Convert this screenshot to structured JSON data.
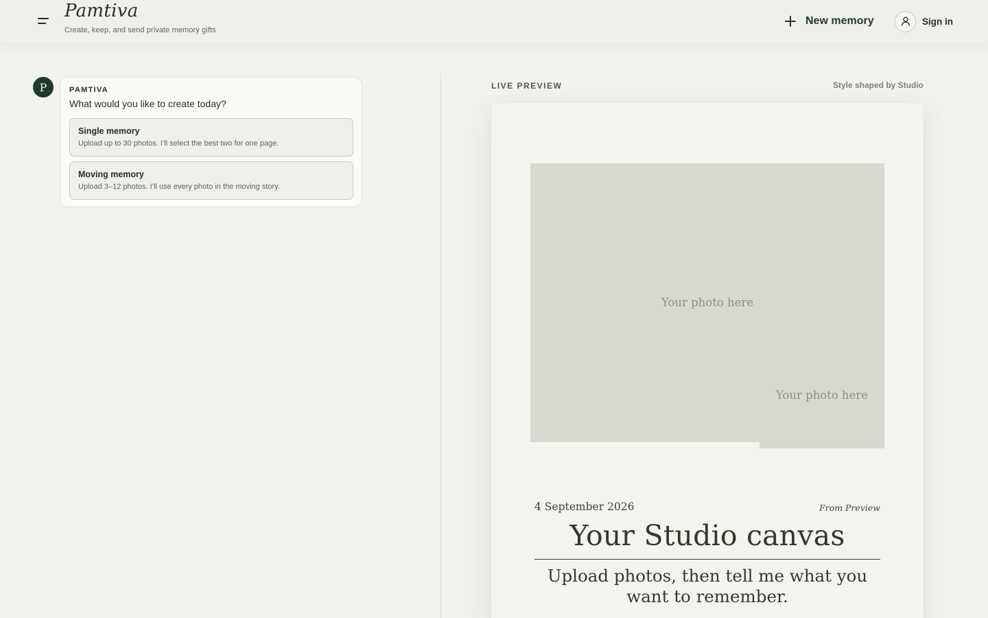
{
  "header": {
    "brand": "Pamtiva",
    "tagline": "Create, keep, and send private memory gifts",
    "new_memory_label": "New memory",
    "sign_in_label": "Sign in",
    "menu_icon": "menu-icon",
    "user_icon": "user-icon",
    "plus_icon": "plus-icon"
  },
  "chat": {
    "avatar_letter": "P",
    "sender": "PAMTIVA",
    "question": "What would you like to create today?",
    "options": [
      {
        "title": "Single memory",
        "description": "Upload up to 30 photos. I’ll select the best two for one page."
      },
      {
        "title": "Moving memory",
        "description": "Upload 3–12 photos. I’ll use every photo in the moving story."
      }
    ]
  },
  "preview": {
    "label": "LIVE PREVIEW",
    "style_note": "Style shaped by Studio",
    "photo_placeholder_main": "Your photo here",
    "photo_placeholder_secondary": "Your photo here",
    "date": "4 September 2026",
    "from": "From Preview",
    "title": "Your Studio canvas",
    "subtitle": "Upload photos, then tell me what you want to remember."
  },
  "colors": {
    "background": "#f3f3ee",
    "accent": "#1f3a2c",
    "photo_placeholder": "#d8d8d1"
  }
}
